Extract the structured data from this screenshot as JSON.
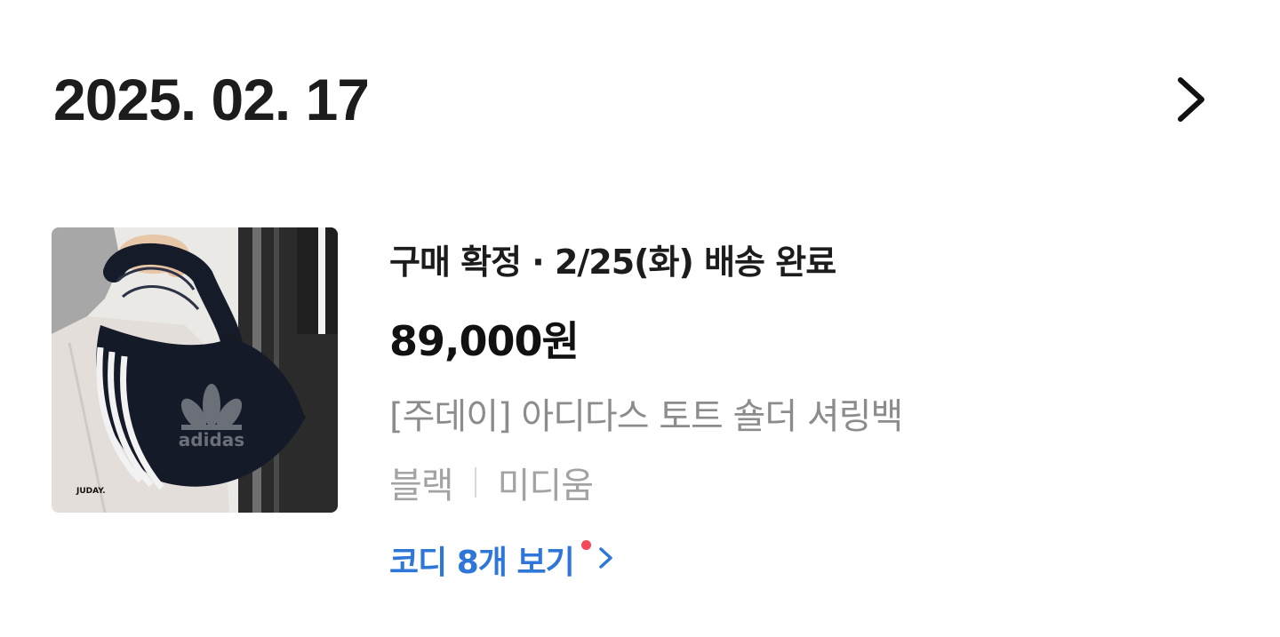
{
  "order": {
    "date": "2025. 02. 17",
    "detail_icon": "chevron-right-icon"
  },
  "item": {
    "status": "구매 확정 · 2/25(화) 배송 완료",
    "price": "89,000원",
    "name": "[주데이] 아디다스 토트 숄더 셔링백",
    "options": [
      "블랙",
      "미디움"
    ],
    "coordi_label": "코디 8개 보기",
    "coordi_icon": "chevron-right-icon",
    "image": {
      "logo_text": "adidas",
      "watermark": "JUDAY."
    }
  },
  "colors": {
    "accent_blue": "#2f76d9",
    "new_dot": "#f24a5a",
    "secondary_text": "#8c8c8c",
    "tertiary_text": "#a3a3a3"
  }
}
